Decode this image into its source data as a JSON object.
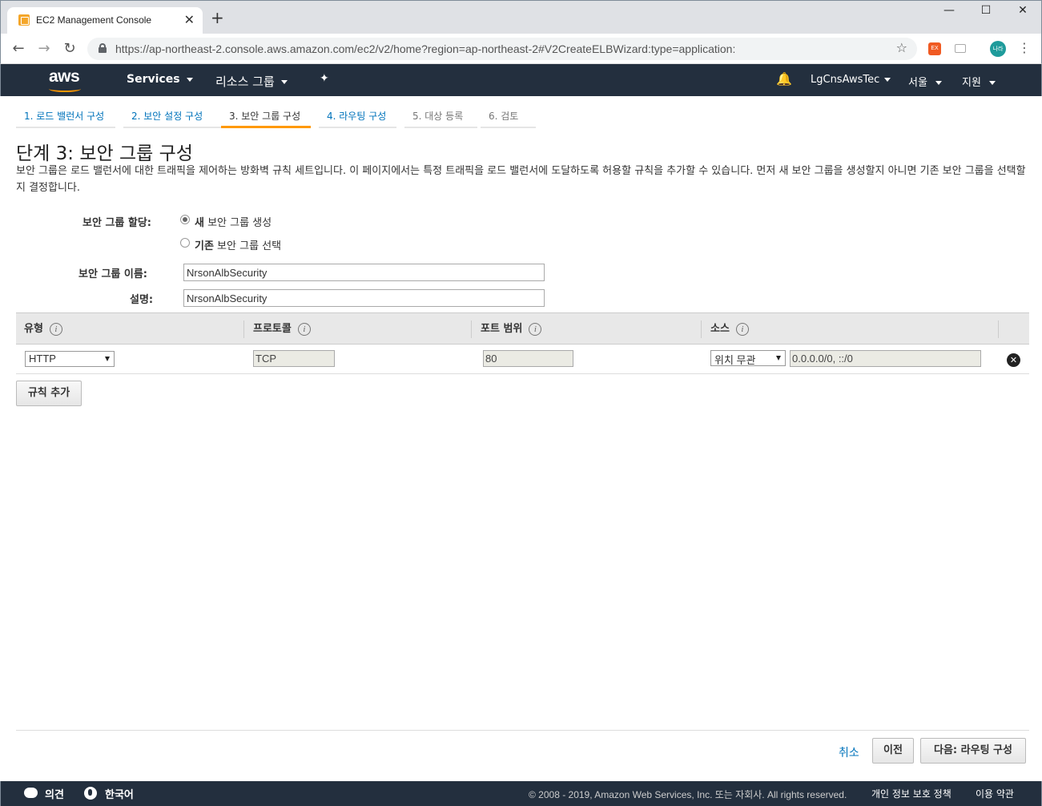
{
  "browser": {
    "tab_title": "EC2 Management Console",
    "new_tab": "+",
    "tab_close": "✕",
    "url": "https://ap-northeast-2.console.aws.amazon.com/ec2/v2/home?region=ap-northeast-2#V2CreateELBWizard:type=application:",
    "back": "←",
    "forward": "→",
    "reload": "↻",
    "star": "☆",
    "menu": "⋮",
    "minimize": "—",
    "maximize": "☐",
    "close": "✕",
    "ext_label": "EX",
    "profile_label": "나라"
  },
  "awsnav": {
    "logo": "aws",
    "services": "Services",
    "resource_groups": "리소스 그룹",
    "pin": "✦",
    "bell": "🔔",
    "account": "LgCnsAwsTec",
    "region": "서울",
    "support": "지원"
  },
  "steps": [
    {
      "label": "1. 로드 밸런서 구성",
      "state": "link"
    },
    {
      "label": "2. 보안 설정 구성",
      "state": "link"
    },
    {
      "label": "3. 보안 그룹 구성",
      "state": "active"
    },
    {
      "label": "4. 라우팅 구성",
      "state": "link"
    },
    {
      "label": "5. 대상 등록",
      "state": "disabled"
    },
    {
      "label": "6. 검토",
      "state": "disabled"
    }
  ],
  "page": {
    "title": "단계 3: 보안 그룹 구성",
    "description": "보안 그룹은 로드 밸런서에 대한 트래픽을 제어하는 방화벽 규칙 세트입니다. 이 페이지에서는 특정 트래픽을 로드 밸런서에 도달하도록 허용할 규칙을 추가할 수 있습니다. 먼저 새 보안 그룹을 생성할지 아니면 기존 보안 그룹을 선택할지 결정합니다."
  },
  "form": {
    "assign_label": "보안 그룹 할당:",
    "option_new_bold": "새",
    "option_new_rest": " 보안 그룹 생성",
    "option_existing_bold": "기존",
    "option_existing_rest": " 보안 그룹 선택",
    "name_label": "보안 그룹 이름:",
    "name_value": "NrsonAlbSecurity",
    "desc_label": "설명:",
    "desc_value": "NrsonAlbSecurity"
  },
  "table": {
    "headers": [
      "유형",
      "프로토콜",
      "포트 범위",
      "소스"
    ],
    "info": "i",
    "rows": [
      {
        "type": "HTTP",
        "protocol": "TCP",
        "port": "80",
        "source_mode": "위치 무관",
        "source": "0.0.0.0/0, ::/0"
      }
    ],
    "remove": "✕"
  },
  "buttons": {
    "add_rule": "규칙 추가",
    "cancel": "취소",
    "previous": "이전",
    "next": "다음: 라우팅 구성"
  },
  "footer": {
    "feedback": "의견",
    "language": "한국어",
    "copyright": "© 2008 - 2019, Amazon Web Services, Inc. 또는 자회사. All rights reserved.",
    "privacy": "개인 정보 보호 정책",
    "terms": "이용 약관"
  },
  "colors": {
    "nav_bg": "#232f3e",
    "accent": "#ff9900",
    "link": "#0073bb"
  }
}
